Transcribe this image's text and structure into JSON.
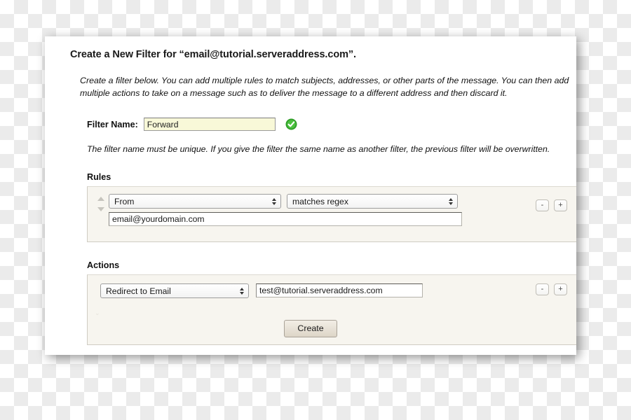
{
  "page": {
    "title": "Create a New Filter for “email@tutorial.serveraddress.com”.",
    "intro": "Create a filter below. You can add multiple rules to match subjects, addresses, or other parts of the message. You can then add multiple actions to take on a message such as to deliver the message to a different address and then discard it."
  },
  "filter_name": {
    "label": "Filter Name:",
    "value": "Forward",
    "placeholder": "",
    "valid_icon": "check-circle-icon",
    "valid_color": "#3aaa35",
    "hint": "The filter name must be unique. If you give the filter the same name as another filter, the previous filter will be overwritten."
  },
  "rules": {
    "heading": "Rules",
    "rows": [
      {
        "field": "From",
        "operator": "matches regex",
        "value": "email@yourdomain.com",
        "value_placeholder": "",
        "move_up_icon": "triangle-up-icon",
        "move_down_icon": "triangle-down-icon"
      }
    ],
    "remove_label": "-",
    "add_label": "+"
  },
  "actions": {
    "heading": "Actions",
    "rows": [
      {
        "action": "Redirect to Email",
        "value": "test@tutorial.serveraddress.com",
        "value_placeholder": ""
      }
    ],
    "remove_label": "-",
    "add_label": "+"
  },
  "submit": {
    "label": "Create"
  },
  "colors": {
    "panel_background": "#f7f5ef",
    "panel_border": "#cfccc3",
    "filter_name_background": "#f8f8d8",
    "button_face": "#ddd5c7"
  }
}
